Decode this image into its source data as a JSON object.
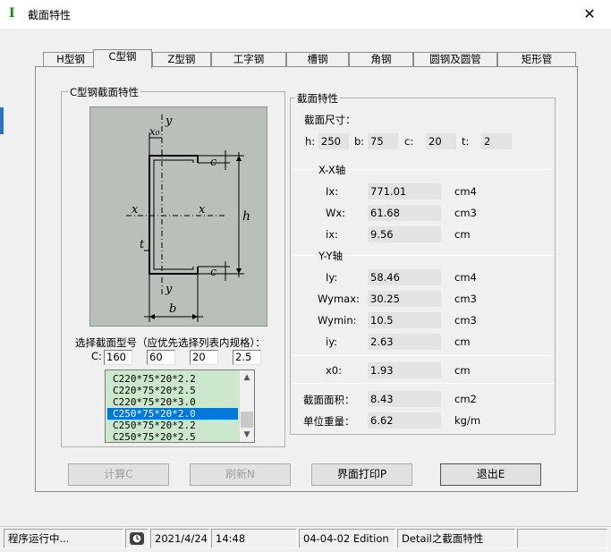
{
  "window": {
    "title": "截面特性",
    "close_glyph": "✕",
    "app_icon_glyph": "I"
  },
  "tabs": [
    {
      "label": "H型钢",
      "active": false
    },
    {
      "label": "C型钢",
      "active": true
    },
    {
      "label": "Z型钢",
      "active": false
    },
    {
      "label": "工字钢",
      "active": false
    },
    {
      "label": "槽钢",
      "active": false
    },
    {
      "label": "角钢",
      "active": false
    },
    {
      "label": "圆钢及圆管",
      "active": false
    },
    {
      "label": "矩形管",
      "active": false
    }
  ],
  "left_group": {
    "title": "C型钢截面特性",
    "figure_labels": {
      "y_top": "y",
      "x0": "x₀",
      "c_top": "c",
      "x_left": "x",
      "x_right": "x",
      "h": "h",
      "t": "t",
      "c_bottom": "c",
      "y_bottom": "y",
      "b": "b"
    },
    "select_prompt": "选择截面型号（应优先选择列表内规格）：",
    "c_label": "C:",
    "inputs": [
      "160",
      "60",
      "20",
      "2.5"
    ],
    "list_items": [
      {
        "text": "C220*75*20*2.2",
        "selected": false
      },
      {
        "text": "C220*75*20*2.5",
        "selected": false
      },
      {
        "text": "C220*75*20*3.0",
        "selected": false
      },
      {
        "text": "C250*75*20*2.0",
        "selected": true
      },
      {
        "text": "C250*75*20*2.2",
        "selected": false
      },
      {
        "text": "C250*75*20*2.5",
        "selected": false
      }
    ]
  },
  "right_group": {
    "title": "截面特性",
    "dims_title": "截面尺寸：",
    "dims": [
      {
        "label": "h:",
        "value": "250"
      },
      {
        "label": "b:",
        "value": "75"
      },
      {
        "label": "c:",
        "value": "20"
      },
      {
        "label": "t:",
        "value": "2"
      }
    ],
    "xx_title": "X-X轴",
    "xx_rows": [
      {
        "label": "Ix:",
        "value": "771.01",
        "unit": "cm4"
      },
      {
        "label": "Wx:",
        "value": "61.68",
        "unit": "cm3"
      },
      {
        "label": "ix:",
        "value": "9.56",
        "unit": "cm"
      }
    ],
    "yy_title": "Y-Y轴",
    "yy_rows": [
      {
        "label": "Iy:",
        "value": "58.46",
        "unit": "cm4"
      },
      {
        "label": "Wymax:",
        "value": "30.25",
        "unit": "cm3"
      },
      {
        "label": "Wymin:",
        "value": "10.5",
        "unit": "cm3"
      },
      {
        "label": "iy:",
        "value": "2.63",
        "unit": "cm"
      }
    ],
    "x0_row": {
      "label": "x0:",
      "value": "1.93",
      "unit": "cm"
    },
    "area_row": {
      "label": "截面面积：",
      "value": "8.43",
      "unit": "cm2"
    },
    "weight_row": {
      "label": "单位重量：",
      "value": "6.62",
      "unit": "kg/m"
    }
  },
  "buttons": {
    "calc": "计算C",
    "refresh": "刷新N",
    "print": "界面打印P",
    "exit": "退出E"
  },
  "status": {
    "state": "程序运行中...",
    "date": "2021/4/24",
    "time": "14:48",
    "edition": "04-04-02 Edition",
    "detail": "Detail之截面特性"
  }
}
